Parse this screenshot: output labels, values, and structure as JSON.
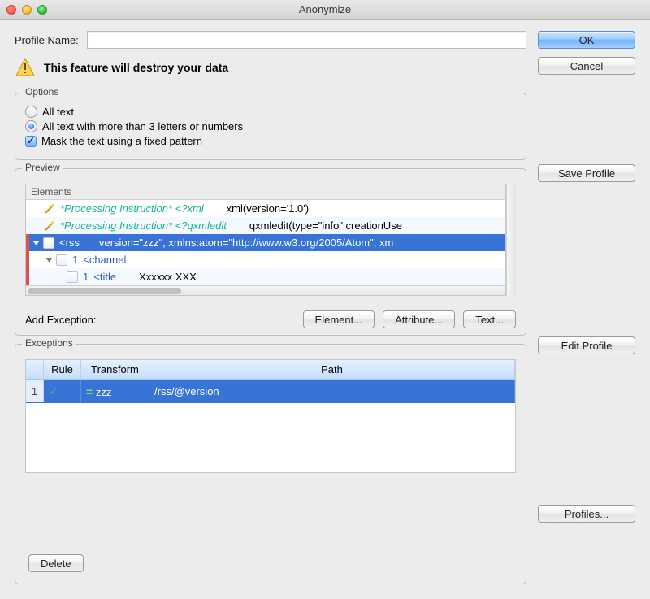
{
  "window": {
    "title": "Anonymize"
  },
  "profile": {
    "label": "Profile Name:",
    "value": ""
  },
  "warning": {
    "text": "This feature will destroy your data"
  },
  "options": {
    "legend": "Options",
    "all_text": "All text",
    "all_text_gt3": "All text with more than 3 letters or numbers",
    "mask_fixed": "Mask the text using a fixed pattern",
    "selected_radio": "gt3",
    "mask_checked": true
  },
  "preview": {
    "legend": "Preview",
    "elements_label": "Elements",
    "rows": [
      {
        "pi": "*Processing Instruction* <?xml",
        "detail": "xml(version='1.0')"
      },
      {
        "pi": "*Processing Instruction* <?qxmledit",
        "detail": "qxmledit(type=\"info\"   creationUse"
      },
      {
        "sel": true,
        "tag": "<rss",
        "attrs": "version=\"zzz\", xmlns:atom=\"http://www.w3.org/2005/Atom\", xm"
      },
      {
        "child": true,
        "num": "1",
        "tag": "<channel"
      },
      {
        "child2": true,
        "num": "1",
        "tag": "<title",
        "detail": "Xxxxxx XXX"
      }
    ]
  },
  "add_exception": {
    "label": "Add Exception:",
    "element_btn": "Element...",
    "attribute_btn": "Attribute...",
    "text_btn": "Text..."
  },
  "exceptions": {
    "legend": "Exceptions",
    "headers": {
      "rule": "Rule",
      "transform": "Transform",
      "path": "Path"
    },
    "rows": [
      {
        "idx": "1",
        "transform": "zzz",
        "path": "/rss/@version"
      }
    ],
    "delete_btn": "Delete"
  },
  "buttons": {
    "ok": "OK",
    "cancel": "Cancel",
    "save_profile": "Save Profile",
    "edit_profile": "Edit Profile",
    "profiles": "Profiles..."
  }
}
